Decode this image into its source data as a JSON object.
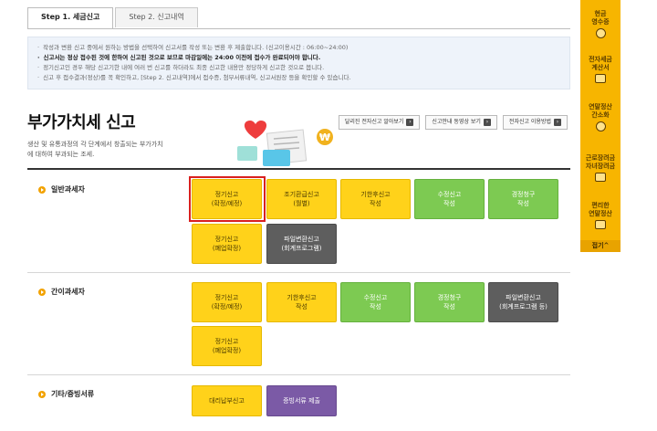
{
  "tabs": [
    {
      "label": "Step 1. 세금신고"
    },
    {
      "label": "Step 2. 신고내역"
    }
  ],
  "notice": [
    "작성과 변환 신고 중에서 원하는 방법을 선택하여 신고서를 작성 또는 변환 후 제출합니다. (신고이용시간 : 06:00~24:00)",
    "신고서는 정상 접수된 것에 한하여 신고된 것으로 보므로 마감일에는 24:00 이전에 접수가 완료되어야 합니다.",
    "정기신고인 경우 해당 신고기한 내에 여러 번 신고를 하더라도 최종 신고한 내용만 정당하게 신고한 것으로 봅니다.",
    "신고 후 접수결과(정상)를 꼭 확인하고, [Step 2. 신고내역]에서 접수증, 첨부서류내역, 신고서원장 등을 확인할 수 있습니다."
  ],
  "page": {
    "title": "부가가치세 신고",
    "subtitle": "생산 및 유통과정의 각 단계에서 창출되는 부가가치에 대하여 부과되는 조세."
  },
  "links": [
    {
      "label": "달리진 전자신고 알아보기"
    },
    {
      "label": "신고안내 동영상 보기"
    },
    {
      "label": "전자신고 이용방법"
    }
  ],
  "sections": {
    "general": {
      "label": "일반과세자",
      "buttons": [
        {
          "label": "정기신고\n(확정/예정)"
        },
        {
          "label": "조기환급신고\n(월별)"
        },
        {
          "label": "기한후신고\n작성"
        },
        {
          "label": "수정신고\n작성"
        },
        {
          "label": "경정청구\n작성"
        },
        {
          "label": "정기신고\n(폐업확정)"
        },
        {
          "label": "파일변환신고\n(회계프로그램)"
        }
      ]
    },
    "simple": {
      "label": "간이과세자",
      "buttons": [
        {
          "label": "정기신고\n(확정/예정)"
        },
        {
          "label": "기한후신고\n작성"
        },
        {
          "label": "수정신고\n작성"
        },
        {
          "label": "경정청구\n작성"
        },
        {
          "label": "파일변환신고\n(회계프로그램 등)"
        },
        {
          "label": "정기신고\n(폐업확정)"
        }
      ]
    },
    "other": {
      "label": "기타/증빙서류",
      "buttons": [
        {
          "label": "대리납부신고"
        },
        {
          "label": "증빙서류 제출"
        }
      ]
    }
  },
  "sidebar": {
    "items": [
      {
        "label": "현금\n영수증"
      },
      {
        "label": "전자세금\n계산서"
      },
      {
        "label": "연말정산\n간소화"
      },
      {
        "label": "근로장려금\n자녀장려금"
      },
      {
        "label": "편리한\n연말정산"
      }
    ],
    "fold_label": "접기^"
  },
  "colors": {
    "yellow": "#ffd21a",
    "green": "#7dca52",
    "gray": "#5e5e5e",
    "purple": "#7b5aa6",
    "sidebar": "#f7b500",
    "highlight": "#d9201f"
  }
}
